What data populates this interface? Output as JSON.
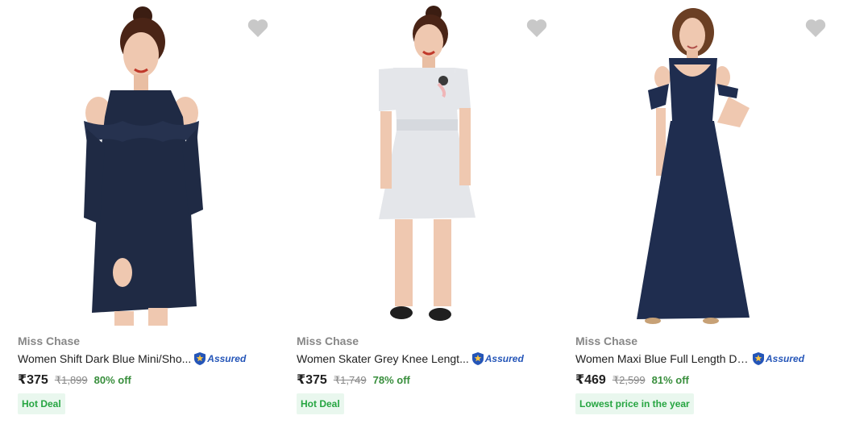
{
  "products": [
    {
      "brand": "Miss Chase",
      "title": "Women Shift Dark Blue Mini/Sho...",
      "assured": "Assured",
      "price": "₹375",
      "mrp": "₹1,899",
      "discount": "80% off",
      "deal": "Hot Deal",
      "wishlist_icon": "heart-icon",
      "dress_color": "#1f2a44"
    },
    {
      "brand": "Miss Chase",
      "title": "Women Skater Grey Knee Lengt...",
      "assured": "Assured",
      "price": "₹375",
      "mrp": "₹1,749",
      "discount": "78% off",
      "deal": "Hot Deal",
      "wishlist_icon": "heart-icon",
      "dress_color": "#e4e6ea"
    },
    {
      "brand": "Miss Chase",
      "title": "Women Maxi Blue Full Length Dr...",
      "assured": "Assured",
      "price": "₹469",
      "mrp": "₹2,599",
      "discount": "81% off",
      "deal": "Lowest price in the year",
      "wishlist_icon": "heart-icon",
      "dress_color": "#1f2d4f"
    }
  ],
  "colors": {
    "discount_green": "#388e3c",
    "deal_bg": "#e9f7ee",
    "deal_text": "#26a541",
    "assured_blue": "#2455b8",
    "brand_grey": "#878787",
    "wishlist_grey": "#c8c8c8"
  }
}
